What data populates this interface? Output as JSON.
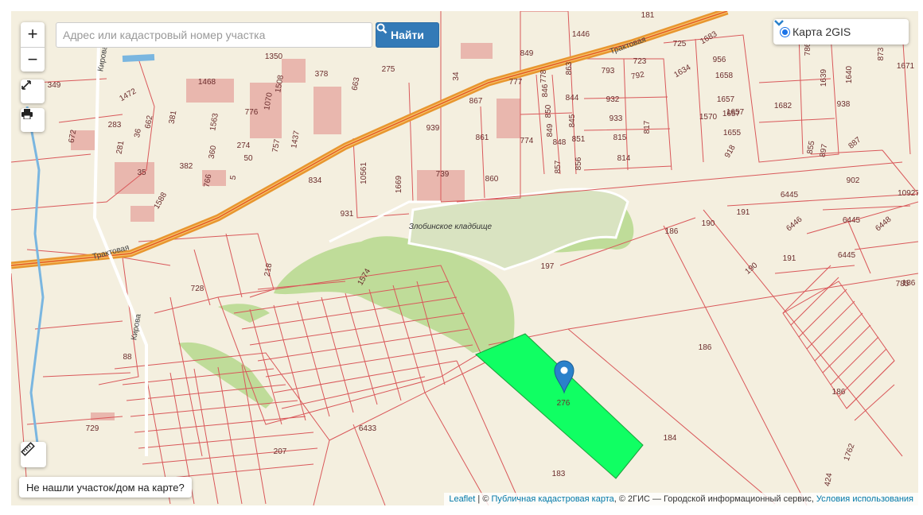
{
  "search": {
    "placeholder": "Адрес или кадастровый номер участка",
    "button_label": "Найти"
  },
  "zoom": {
    "in_label": "+",
    "out_label": "−"
  },
  "layer": {
    "selected": "Карта 2GIS"
  },
  "not_found_label": "Не нашли участок/дом на карте?",
  "attribution": {
    "leaflet": "Leaflet",
    "sep1": " | © ",
    "pkk": "Публичная кадастровая карта",
    "mid": ", © 2ГИС — Городской информационный сервис, ",
    "terms": "Условия использования"
  },
  "map": {
    "roads": [
      {
        "name": "Трактовая"
      },
      {
        "name": "Трактовая"
      },
      {
        "name": "Кирова"
      },
      {
        "name": "Кирова"
      }
    ],
    "landmarks": [
      {
        "name": "Злобинское кладбище"
      }
    ],
    "parcels": [
      {
        "label": "1350"
      },
      {
        "label": "378"
      },
      {
        "label": "275"
      },
      {
        "label": "34"
      },
      {
        "label": "849"
      },
      {
        "label": "1446"
      },
      {
        "label": "181"
      },
      {
        "label": "1683"
      },
      {
        "label": "725"
      },
      {
        "label": "956"
      },
      {
        "label": "723"
      },
      {
        "label": "793"
      },
      {
        "label": "792"
      },
      {
        "label": "1634"
      },
      {
        "label": "1658"
      },
      {
        "label": "778"
      },
      {
        "label": "863"
      },
      {
        "label": "777"
      },
      {
        "label": "846"
      },
      {
        "label": "844"
      },
      {
        "label": "867"
      },
      {
        "label": "1468"
      },
      {
        "label": "1508"
      },
      {
        "label": "663"
      },
      {
        "label": "349"
      },
      {
        "label": "1472"
      },
      {
        "label": "1070"
      },
      {
        "label": "776"
      },
      {
        "label": "1563"
      },
      {
        "label": "381"
      },
      {
        "label": "662"
      },
      {
        "label": "283"
      },
      {
        "label": "36"
      },
      {
        "label": "757"
      },
      {
        "label": "1437"
      },
      {
        "label": "939"
      },
      {
        "label": "861"
      },
      {
        "label": "774"
      },
      {
        "label": "850"
      },
      {
        "label": "849"
      },
      {
        "label": "845"
      },
      {
        "label": "932"
      },
      {
        "label": "933"
      },
      {
        "label": "817"
      },
      {
        "label": "1570"
      },
      {
        "label": "1657"
      },
      {
        "label": "1682"
      },
      {
        "label": "938"
      },
      {
        "label": "1655"
      },
      {
        "label": "815"
      },
      {
        "label": "814"
      },
      {
        "label": "851"
      },
      {
        "label": "848"
      },
      {
        "label": "857"
      },
      {
        "label": "856"
      },
      {
        "label": "274"
      },
      {
        "label": "50"
      },
      {
        "label": "360"
      },
      {
        "label": "281"
      },
      {
        "label": "672"
      },
      {
        "label": "35"
      },
      {
        "label": "382"
      },
      {
        "label": "766"
      },
      {
        "label": "5"
      },
      {
        "label": "834"
      },
      {
        "label": "10561"
      },
      {
        "label": "1669"
      },
      {
        "label": "739"
      },
      {
        "label": "860"
      },
      {
        "label": "918"
      },
      {
        "label": "855"
      },
      {
        "label": "897"
      },
      {
        "label": "887"
      },
      {
        "label": "902"
      },
      {
        "label": "10927"
      },
      {
        "label": "6445"
      },
      {
        "label": "6446"
      },
      {
        "label": "6445"
      },
      {
        "label": "6448"
      },
      {
        "label": "6445"
      },
      {
        "label": "191"
      },
      {
        "label": "191"
      },
      {
        "label": "190"
      },
      {
        "label": "190"
      },
      {
        "label": "186"
      },
      {
        "label": "186"
      },
      {
        "label": "186"
      },
      {
        "label": "186"
      },
      {
        "label": "785"
      },
      {
        "label": "1588"
      },
      {
        "label": "931"
      },
      {
        "label": "218"
      },
      {
        "label": "1574"
      },
      {
        "label": "197"
      },
      {
        "label": "728"
      },
      {
        "label": "88"
      },
      {
        "label": "729"
      },
      {
        "label": "207"
      },
      {
        "label": "6433"
      },
      {
        "label": "183"
      },
      {
        "label": "184"
      },
      {
        "label": "1762"
      },
      {
        "label": "424"
      },
      {
        "label": "792"
      },
      {
        "label": "1639"
      },
      {
        "label": "1640"
      },
      {
        "label": "1671"
      },
      {
        "label": "786"
      },
      {
        "label": "873"
      },
      {
        "label": "276"
      },
      {
        "label": "1657"
      },
      {
        "label": "1657"
      }
    ],
    "highlighted_parcel": {
      "color": "#10ff63"
    },
    "marker": {
      "color": "#2a81cb"
    }
  }
}
